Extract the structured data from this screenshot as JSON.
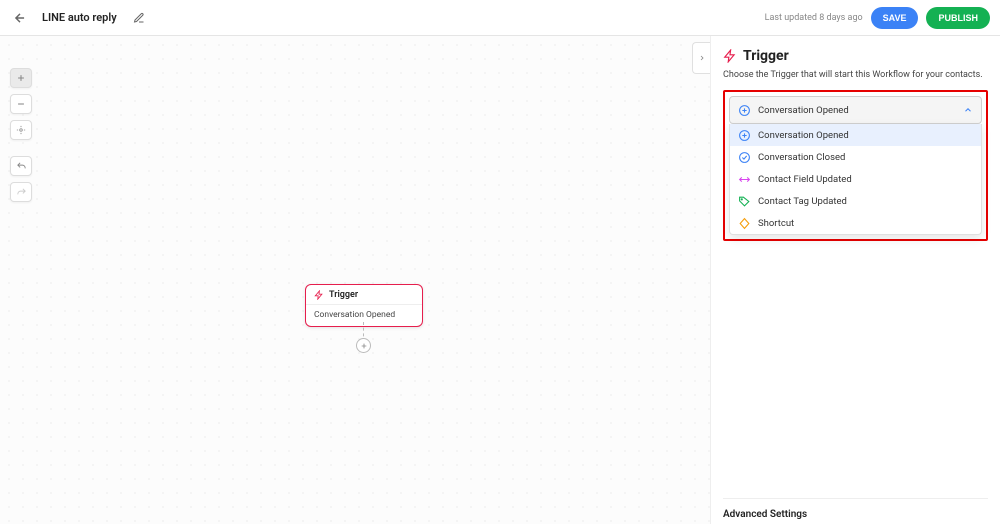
{
  "header": {
    "title": "LINE auto reply",
    "last_updated": "Last updated 8 days ago",
    "save_label": "SAVE",
    "publish_label": "PUBLISH"
  },
  "canvas": {
    "node": {
      "title": "Trigger",
      "detail": "Conversation Opened"
    }
  },
  "sidebar": {
    "title": "Trigger",
    "description": "Choose the Trigger that will start this Workflow for your contacts.",
    "selected": "Conversation Opened",
    "options": [
      {
        "label": "Conversation Opened",
        "icon_color": "#3b82f6",
        "icon": "circle-plus"
      },
      {
        "label": "Conversation Closed",
        "icon_color": "#3b82f6",
        "icon": "circle-check"
      },
      {
        "label": "Contact Field Updated",
        "icon_color": "#d946ef",
        "icon": "swap"
      },
      {
        "label": "Contact Tag Updated",
        "icon_color": "#14b153",
        "icon": "tag"
      },
      {
        "label": "Shortcut",
        "icon_color": "#f59e0b",
        "icon": "diamond"
      }
    ],
    "advanced_label": "Advanced Settings"
  }
}
